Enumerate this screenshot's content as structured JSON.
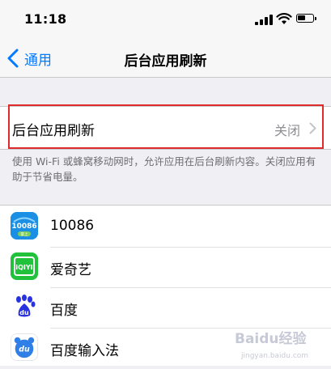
{
  "status_bar": {
    "time": "11:18"
  },
  "nav": {
    "back_label": "通用",
    "title": "后台应用刷新"
  },
  "main_setting": {
    "label": "后台应用刷新",
    "value": "关闭"
  },
  "footnote": "使用 Wi-Fi 或蜂窝移动网时，允许应用在后台刷新内容。关闭应用有助于节省电量。",
  "apps": [
    {
      "name": "10086",
      "icon": "china-mobile-10086-icon",
      "icon_text": "10086",
      "icon_subtext": "掌上"
    },
    {
      "name": "爱奇艺",
      "icon": "iqiyi-icon",
      "icon_text": "iQIYI"
    },
    {
      "name": "百度",
      "icon": "baidu-icon",
      "icon_text": "du"
    },
    {
      "name": "百度输入法",
      "icon": "baidu-input-icon",
      "icon_text": "du"
    }
  ],
  "watermark": {
    "text": "Baidu经验",
    "subtext": "jingyan.baidu.com"
  },
  "colors": {
    "accent": "#007aff",
    "highlight": "#e02b2b",
    "secondary_text": "#8e8e93",
    "background": "#efeff4"
  }
}
